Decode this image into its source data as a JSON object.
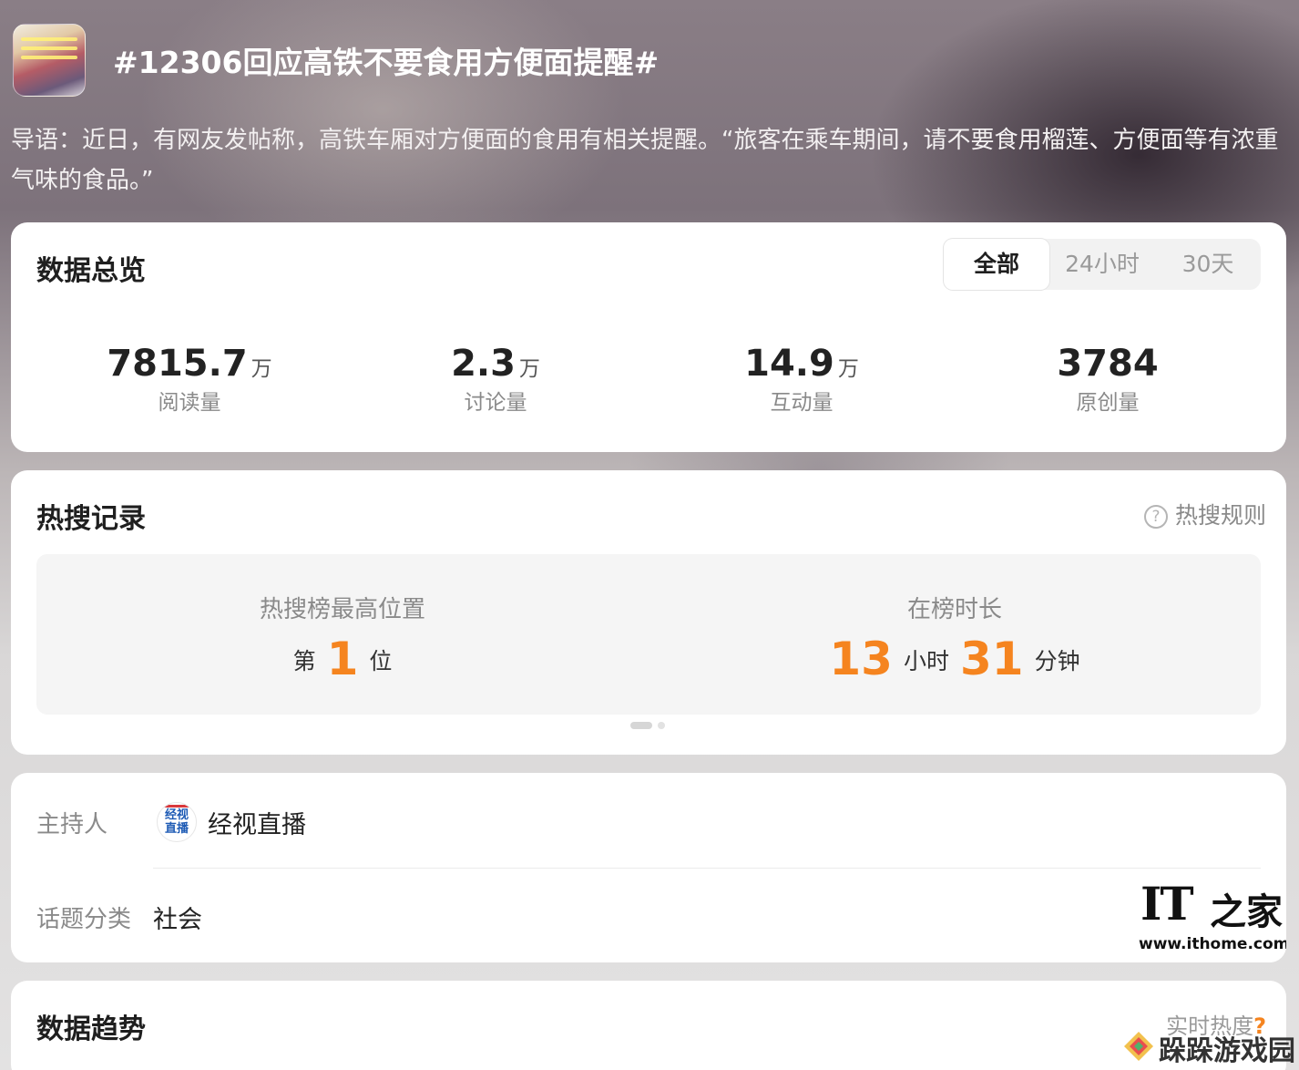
{
  "topic": {
    "title": "#12306回应高铁不要食用方便面提醒#",
    "intro": "导语：近日，有网友发帖称，高铁车厢对方便面的食用有相关提醒。“旅客在乘车期间，请不要食用榴莲、方便面等有浓重气味的食品。”"
  },
  "overview": {
    "title": "数据总览",
    "tabs": [
      {
        "label": "全部",
        "active": true
      },
      {
        "label": "24小时",
        "active": false
      },
      {
        "label": "30天",
        "active": false
      }
    ],
    "stats": [
      {
        "value": "7815.7",
        "unit": "万",
        "label": "阅读量"
      },
      {
        "value": "2.3",
        "unit": "万",
        "label": "讨论量"
      },
      {
        "value": "14.9",
        "unit": "万",
        "label": "互动量"
      },
      {
        "value": "3784",
        "unit": "",
        "label": "原创量"
      }
    ]
  },
  "hot_search": {
    "title": "热搜记录",
    "rules_label": "热搜规则",
    "rules_icon": "question-circle-icon",
    "best_position": {
      "caption": "热搜榜最高位置",
      "prefix": "第",
      "value": "1",
      "suffix": "位"
    },
    "duration": {
      "caption": "在榜时长",
      "hours": "13",
      "hours_unit": "小时",
      "minutes": "31",
      "minutes_unit": "分钟"
    },
    "pager": {
      "pages": 2,
      "current": 1
    }
  },
  "info": {
    "host_label": "主持人",
    "host_name": "经视直播",
    "host_avatar_text_1": "经视",
    "host_avatar_text_2": "直播",
    "category_label": "话题分类",
    "category_value": "社会"
  },
  "trend": {
    "title": "数据趋势",
    "realtime_label": "实时热度",
    "realtime_icon": "?"
  },
  "watermarks": {
    "ithome_logo": "IT",
    "ithome_cn": "之家",
    "ithome_url": "www.ithome.com",
    "site_name": "跺跺游戏园"
  },
  "colors": {
    "accent": "#f5841f",
    "card_bg": "#ffffff",
    "muted_text": "#8a8a8a"
  }
}
